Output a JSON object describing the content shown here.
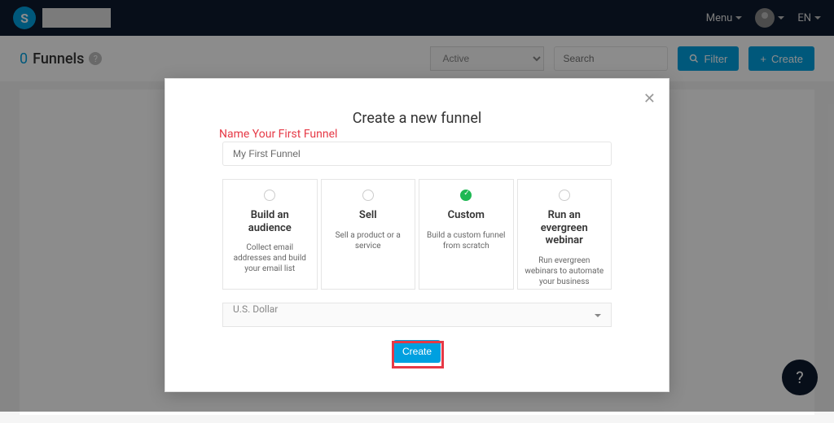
{
  "header": {
    "logo_letter": "S",
    "menu_label": "Menu",
    "lang_label": "EN"
  },
  "toolbar": {
    "count": "0",
    "title": "Funnels",
    "status_filter": "Active",
    "search_placeholder": "Search",
    "filter_label": "Filter",
    "create_label": "Create"
  },
  "modal": {
    "title": "Create a new funnel",
    "annotation": "Name Your First Funnel",
    "name_value": "My First Funnel",
    "options": [
      {
        "title": "Build an audience",
        "desc": "Collect email addresses and build your email list",
        "selected": false
      },
      {
        "title": "Sell",
        "desc": "Sell a product or a service",
        "selected": false
      },
      {
        "title": "Custom",
        "desc": "Build a custom funnel from scratch",
        "selected": true
      },
      {
        "title": "Run an evergreen webinar",
        "desc": "Run evergreen webinars to automate your business",
        "selected": false
      }
    ],
    "currency": "U.S. Dollar",
    "create_button": "Create"
  },
  "help_fab": "?"
}
